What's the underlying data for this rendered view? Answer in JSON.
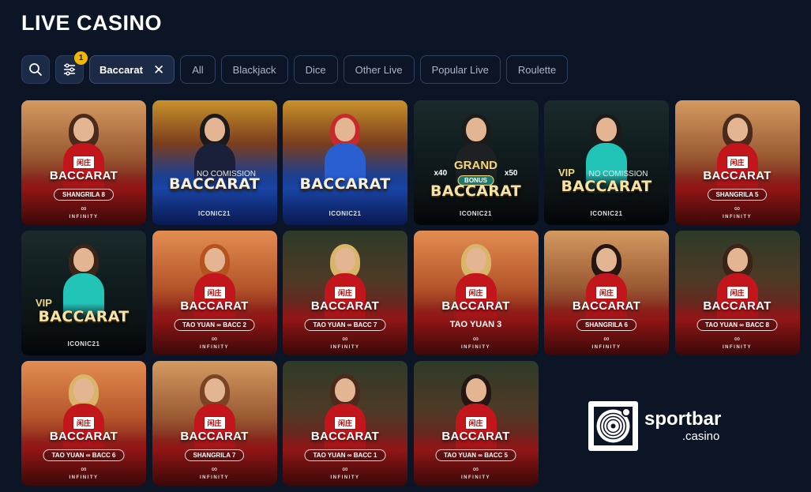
{
  "page": {
    "title": "LIVE CASINO"
  },
  "filters": {
    "badge_count": "1",
    "active_chip": "Baccarat",
    "chips": [
      "All",
      "Blackjack",
      "Dice",
      "Other Live",
      "Popular Live",
      "Roulette"
    ]
  },
  "colors": {
    "background": "#0c1526",
    "chip_border": "#2f4262",
    "badge": "#f2b705"
  },
  "games": [
    {
      "style": "warm",
      "top_label": "",
      "title": "BACCARAT",
      "subtitle": "SHANGRILA 8",
      "provider": "INFINITY",
      "hair": "#4a2a1a",
      "dress": "#c2161c",
      "title_style": "normal"
    },
    {
      "style": "blue",
      "top_label": "NO COMISSION",
      "title": "BACCARAT",
      "subtitle": "",
      "provider": "ICONIC21",
      "hair": "#1b1b1b",
      "dress": "#1a1f3a",
      "title_style": "big"
    },
    {
      "style": "blue",
      "top_label": "",
      "title": "BACCARAT",
      "subtitle": "",
      "provider": "ICONIC21",
      "hair": "#c62b2b",
      "dress": "#2a5fd1",
      "title_style": "big"
    },
    {
      "style": "dark",
      "top_label": "GRAND",
      "title": "BACCARAT",
      "subtitle": "",
      "provider": "ICONIC21",
      "hair": "#1b1b1b",
      "dress": "#1e2124",
      "title_style": "big-gold",
      "bonus": "BONUS",
      "mult_left": "x40",
      "mult_right": "x50"
    },
    {
      "style": "dark",
      "top_label": "NO COMISSION",
      "vip": "VIP",
      "title": "BACCARAT",
      "subtitle": "",
      "provider": "ICONIC21",
      "hair": "#1b1b1b",
      "dress": "#22c4b8",
      "title_style": "big-gold"
    },
    {
      "style": "warm",
      "top_label": "",
      "title": "BACCARAT",
      "subtitle": "SHANGRILA 5",
      "provider": "INFINITY",
      "hair": "#4a2a1a",
      "dress": "#c2161c",
      "title_style": "normal"
    },
    {
      "style": "dark",
      "top_label": "",
      "vip": "VIP",
      "title": "BACCARAT",
      "subtitle": "",
      "provider": "ICONIC21",
      "hair": "#3a2418",
      "dress": "#22c4b8",
      "title_style": "big-gold"
    },
    {
      "style": "orange",
      "top_label": "",
      "title": "BACCARAT",
      "subtitle": "TAO YUAN ∞ BACC 2",
      "provider": "INFINITY",
      "hair": "#b5531f",
      "dress": "#c2161c",
      "title_style": "normal"
    },
    {
      "style": "green",
      "top_label": "",
      "title": "BACCARAT",
      "subtitle": "TAO YUAN ∞ BACC 7",
      "provider": "INFINITY",
      "hair": "#d9b56a",
      "dress": "#c2161c",
      "title_style": "normal"
    },
    {
      "style": "orange",
      "top_label": "",
      "title": "BACCARAT",
      "subtitle": "TAO YUAN 3",
      "provider": "INFINITY",
      "hair": "#d9b56a",
      "dress": "#c2161c",
      "title_style": "normal",
      "subtitle_plain": true
    },
    {
      "style": "warm",
      "top_label": "",
      "title": "BACCARAT",
      "subtitle": "SHANGRILA 6",
      "provider": "INFINITY",
      "hair": "#241612",
      "dress": "#c2161c",
      "title_style": "normal"
    },
    {
      "style": "green",
      "top_label": "",
      "title": "BACCARAT",
      "subtitle": "TAO YUAN ∞ BACC 8",
      "provider": "INFINITY",
      "hair": "#3a2418",
      "dress": "#c2161c",
      "title_style": "normal"
    },
    {
      "style": "orange",
      "top_label": "",
      "title": "BACCARAT",
      "subtitle": "TAO YUAN ∞ BACC 6",
      "provider": "INFINITY",
      "hair": "#d9b56a",
      "dress": "#c2161c",
      "title_style": "normal"
    },
    {
      "style": "warm",
      "top_label": "",
      "title": "BACCARAT",
      "subtitle": "SHANGRILA 7",
      "provider": "INFINITY",
      "hair": "#7a4424",
      "dress": "#c2161c",
      "title_style": "normal"
    },
    {
      "style": "green",
      "top_label": "",
      "title": "BACCARAT",
      "subtitle": "TAO YUAN ∞ BACC 1",
      "provider": "INFINITY",
      "hair": "#4a2a1a",
      "dress": "#c2161c",
      "title_style": "normal"
    },
    {
      "style": "green",
      "top_label": "",
      "title": "BACCARAT",
      "subtitle": "TAO YUAN ∞ BACC 5",
      "provider": "INFINITY",
      "hair": "#241612",
      "dress": "#c2161c",
      "title_style": "normal"
    }
  ],
  "brand": {
    "name": "sportbar",
    "suffix": ".casino"
  }
}
